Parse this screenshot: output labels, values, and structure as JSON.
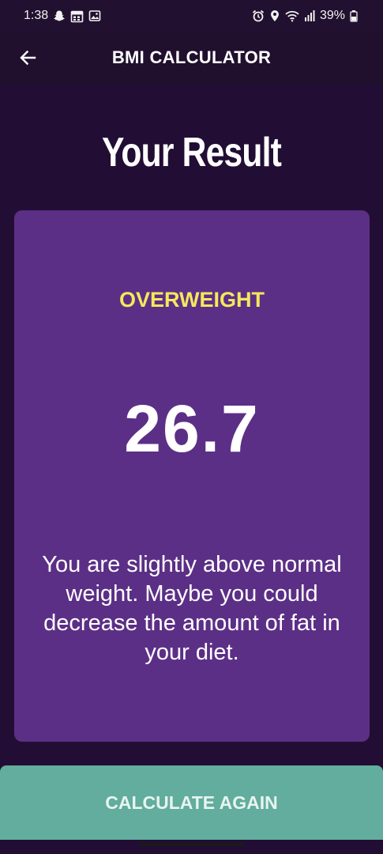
{
  "status_bar": {
    "time": "1:38",
    "battery": "39%",
    "icons": [
      "snapchat-icon",
      "calendar-icon",
      "gallery-icon",
      "alarm-icon",
      "location-icon",
      "wifi-icon",
      "signal-icon",
      "battery-icon"
    ]
  },
  "app_bar": {
    "title": "BMI CALCULATOR",
    "back_icon": "arrow-back-icon"
  },
  "page": {
    "title": "Your Result"
  },
  "result": {
    "category": "OVERWEIGHT",
    "bmi": "26.7",
    "advice": "You are slightly above normal weight. Maybe you could decrease the amount of fat in your diet."
  },
  "action": {
    "label": "CALCULATE AGAIN"
  },
  "colors": {
    "background": "#220e34",
    "card": "#5c2f86",
    "category": "#f5e85c",
    "button": "#62ad9d"
  }
}
